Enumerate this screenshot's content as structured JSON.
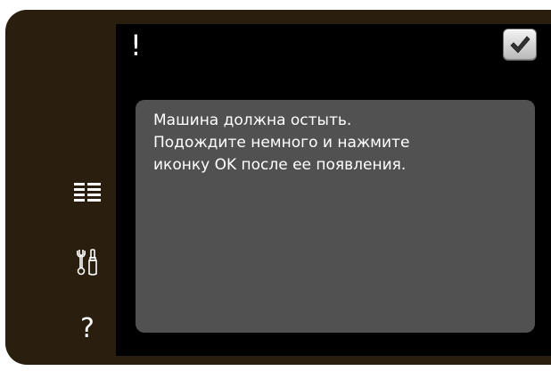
{
  "sidebar": {
    "items": [
      {
        "icon": "menu-list-icon"
      },
      {
        "icon": "tools-icon"
      },
      {
        "icon": "help-icon",
        "glyph": "?"
      }
    ]
  },
  "dialog": {
    "alert_symbol": "!",
    "confirm_icon": "checkmark-icon",
    "message_lines": [
      "Машина должна остыть.",
      "Подождите немного и нажмите",
      "иконку OK после ее появления."
    ]
  },
  "colors": {
    "frame": "#2a1e0e",
    "screen": "#000000",
    "panel": "#515151",
    "text": "#ffffff",
    "confirm_button": "#d9d9d9",
    "checkmark": "#333333"
  }
}
